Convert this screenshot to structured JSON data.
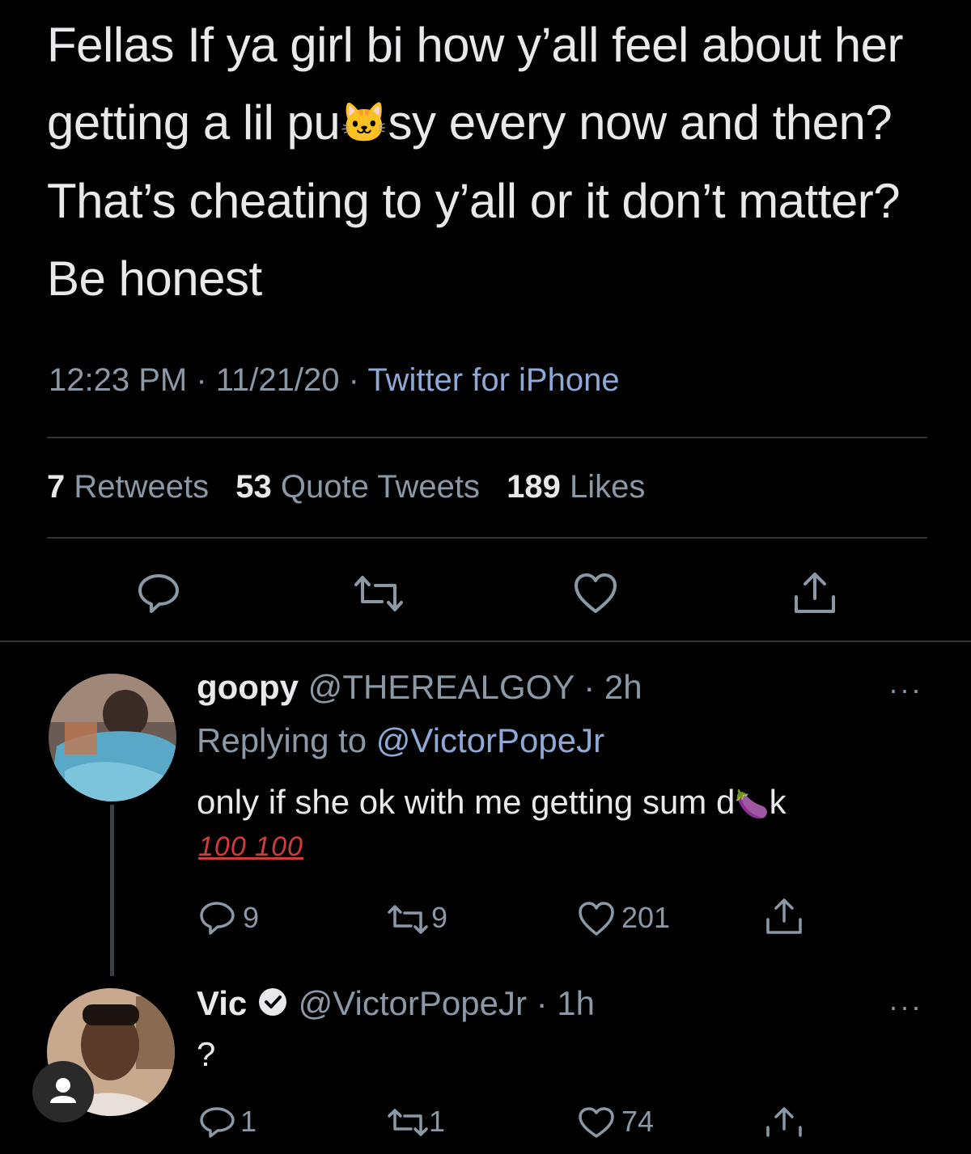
{
  "tweet": {
    "text_part1": "Fellas If ya girl bi how y’all feel about her getting a lil pu",
    "text_emoji": "🐱",
    "text_part2": "sy every now and then? That’s cheating to y’all or it don’t matter? Be honest",
    "time": "12:23 PM",
    "sep1": " · ",
    "date": "11/21/20",
    "sep2": " · ",
    "source": "Twitter for iPhone",
    "retweets_count": "7",
    "retweets_label": "Retweets",
    "quotes_count": "53",
    "quotes_label": "Quote Tweets",
    "likes_count": "189",
    "likes_label": "Likes"
  },
  "reply1": {
    "name": "goopy",
    "handle": "@THEREALGOY",
    "time": " · 2h",
    "replying_label": "Replying to",
    "replying_handle": "@VictorPopeJr",
    "text_part1": "only if she ok with me getting sum d",
    "text_emoji": "🍆",
    "text_part2": "k",
    "hundreds": "100 100",
    "replies": "9",
    "retweets": "9",
    "likes": "201",
    "more": "···"
  },
  "reply2": {
    "name": "Vic",
    "handle": "@VictorPopeJr",
    "time": " · 1h",
    "text": "?",
    "replies": "1",
    "retweets": "1",
    "likes": "74",
    "more": "···"
  },
  "colors": {
    "background": "#000000",
    "text": "#e7e9ea",
    "secondary": "#8b98a5",
    "link": "#8ea9d6"
  }
}
